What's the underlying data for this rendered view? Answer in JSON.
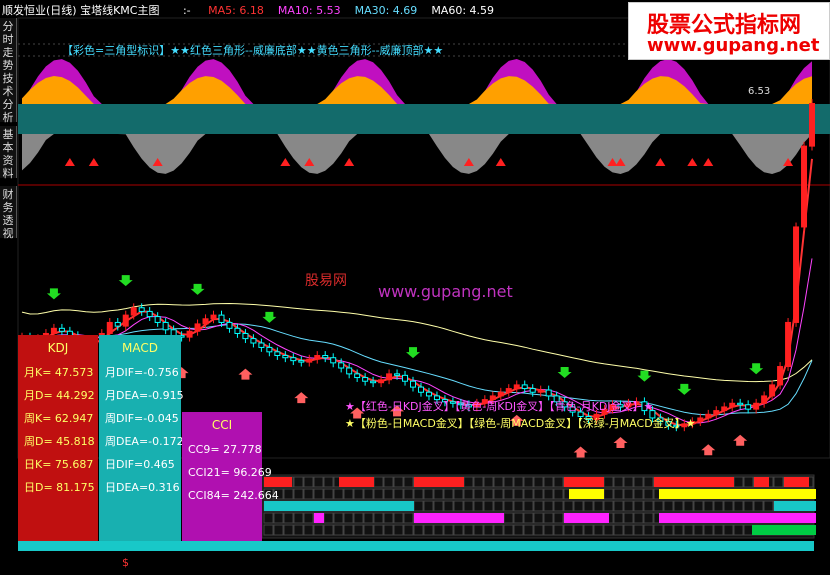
{
  "header": {
    "title": "顺发恒业(日线) 宝塔线KMC主图",
    "dash": ":-",
    "ma_items": [
      {
        "label": "MA5: 6.18",
        "color": "#ff3333"
      },
      {
        "label": "MA10: 5.53",
        "color": "#ff44ff"
      },
      {
        "label": "MA30: 4.69",
        "color": "#66ddff"
      },
      {
        "label": "MA60: 4.59",
        "color": "#ffffff"
      }
    ]
  },
  "side_tabs": [
    "分时走势",
    "技术分析",
    "基本资料",
    "财务透视"
  ],
  "watermark": {
    "top": "股票公式指标网",
    "bottom": "www.gupang.net",
    "center": "www.gupang.net",
    "center_cn": "股易网"
  },
  "legend_top": "【彩色=三角型标识】★★红色三角形--威廉底部★★黄色三角形--威廉顶部★★",
  "legend_bottom_1": "★【红色-日KDJ金叉】【黄色-周KDJ金叉】【青色-月KDJ金叉】★",
  "legend_bottom_2": "★【粉色-日MACD金叉】【绿色-周MACD金叉】【深绿-月MACD金叉】★",
  "price_label": "6.53",
  "kdj": {
    "title": "KDJ",
    "rows": [
      "月K= 47.573",
      "月D= 44.292",
      "周K= 62.947",
      "周D= 45.818",
      "日K= 75.687",
      "日D= 81.175"
    ]
  },
  "macd": {
    "title": "MACD",
    "rows": [
      "月DIF=-0.756",
      "月DEA=-0.915",
      "周DIF=-0.045",
      "周DEA=-0.172",
      "日DIF=0.465",
      "日DEA=0.316"
    ]
  },
  "cci": {
    "title": "CCI",
    "rows": [
      "CC9= 27.778",
      "CCI21= 96.269",
      "CCI84= 242.664"
    ]
  },
  "bottom_mark": "$",
  "colors": {
    "up": "#ff2020",
    "down": "#00ffff",
    "ma5": "#ff3333",
    "ma10": "#ff44ff",
    "ma30": "#66ddff",
    "ma60": "#ffffaa",
    "panel_kdj": "#c01010",
    "panel_macd": "#18b0b0",
    "panel_cci": "#b010b0"
  },
  "chart_data": {
    "type": "candlestick",
    "series_close": [
      3.0,
      2.95,
      2.98,
      3.05,
      3.12,
      3.08,
      3.02,
      2.96,
      2.9,
      2.92,
      3.05,
      3.2,
      3.15,
      3.3,
      3.4,
      3.35,
      3.28,
      3.2,
      3.1,
      3.02,
      3.0,
      3.08,
      3.18,
      3.25,
      3.3,
      3.2,
      3.12,
      3.05,
      2.98,
      2.92,
      2.86,
      2.8,
      2.75,
      2.72,
      2.68,
      2.66,
      2.7,
      2.75,
      2.72,
      2.65,
      2.58,
      2.5,
      2.45,
      2.4,
      2.38,
      2.42,
      2.5,
      2.48,
      2.4,
      2.32,
      2.25,
      2.2,
      2.15,
      2.12,
      2.1,
      2.08,
      2.05,
      2.1,
      2.15,
      2.2,
      2.25,
      2.3,
      2.35,
      2.3,
      2.25,
      2.28,
      2.2,
      2.12,
      2.05,
      1.98,
      1.92,
      1.88,
      1.95,
      2.02,
      2.08,
      2.05,
      2.1,
      2.12,
      2.0,
      1.9,
      1.85,
      1.8,
      1.78,
      1.82,
      1.85,
      1.9,
      1.95,
      2.0,
      2.05,
      2.1,
      2.08,
      2.02,
      2.1,
      2.2,
      2.35,
      2.6,
      3.2,
      4.5,
      5.6,
      6.18
    ]
  }
}
